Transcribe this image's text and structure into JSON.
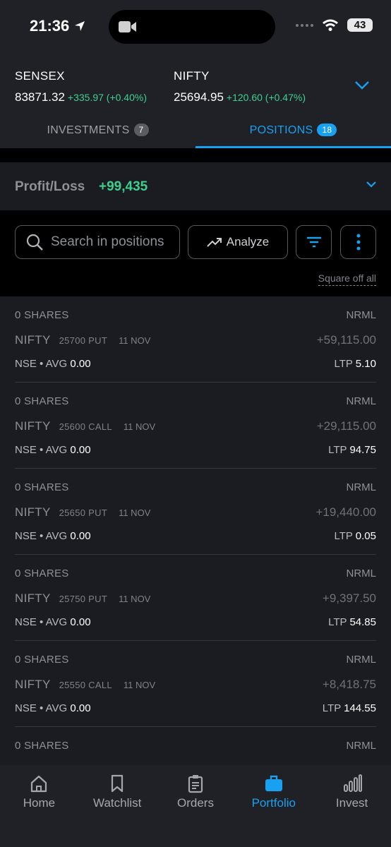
{
  "status_bar": {
    "time": "21:36",
    "battery": "43"
  },
  "indices": [
    {
      "name": "SENSEX",
      "value": "83871.32",
      "change": "+335.97 (+0.40%)"
    },
    {
      "name": "NIFTY",
      "value": "25694.95",
      "change": "+120.60 (+0.47%)"
    }
  ],
  "tabs": [
    {
      "label": "INVESTMENTS",
      "count": "7"
    },
    {
      "label": "POSITIONS",
      "count": "18"
    }
  ],
  "pnl": {
    "label": "Profit/Loss",
    "value": "+99,435"
  },
  "toolbar": {
    "search_placeholder": "Search in positions",
    "analyze_label": "Analyze",
    "square_off_label": "Square off all"
  },
  "positions": [
    {
      "qty": "0 SHARES",
      "product": "NRML",
      "symbol": "NIFTY",
      "strike": "25700 PUT",
      "expiry": "11 NOV",
      "pnl": "+59,115.00",
      "exchange": "NSE",
      "avg_label": "AVG",
      "avg": "0.00",
      "ltp_label": "LTP",
      "ltp": "5.10"
    },
    {
      "qty": "0 SHARES",
      "product": "NRML",
      "symbol": "NIFTY",
      "strike": "25600 CALL",
      "expiry": "11 NOV",
      "pnl": "+29,115.00",
      "exchange": "NSE",
      "avg_label": "AVG",
      "avg": "0.00",
      "ltp_label": "LTP",
      "ltp": "94.75"
    },
    {
      "qty": "0 SHARES",
      "product": "NRML",
      "symbol": "NIFTY",
      "strike": "25650 PUT",
      "expiry": "11 NOV",
      "pnl": "+19,440.00",
      "exchange": "NSE",
      "avg_label": "AVG",
      "avg": "0.00",
      "ltp_label": "LTP",
      "ltp": "0.05"
    },
    {
      "qty": "0 SHARES",
      "product": "NRML",
      "symbol": "NIFTY",
      "strike": "25750 PUT",
      "expiry": "11 NOV",
      "pnl": "+9,397.50",
      "exchange": "NSE",
      "avg_label": "AVG",
      "avg": "0.00",
      "ltp_label": "LTP",
      "ltp": "54.85"
    },
    {
      "qty": "0 SHARES",
      "product": "NRML",
      "symbol": "NIFTY",
      "strike": "25550 CALL",
      "expiry": "11 NOV",
      "pnl": "+8,418.75",
      "exchange": "NSE",
      "avg_label": "AVG",
      "avg": "0.00",
      "ltp_label": "LTP",
      "ltp": "144.55"
    },
    {
      "qty": "0 SHARES",
      "product": "NRML"
    }
  ],
  "bottom_nav": [
    {
      "label": "Home",
      "icon": "home-icon"
    },
    {
      "label": "Watchlist",
      "icon": "bookmark-icon"
    },
    {
      "label": "Orders",
      "icon": "clipboard-icon"
    },
    {
      "label": "Portfolio",
      "icon": "briefcase-icon"
    },
    {
      "label": "Invest",
      "icon": "bar-chart-icon"
    }
  ],
  "colors": {
    "accent": "#1aa0f0",
    "profit": "#3ecf8e",
    "background": "#1a1c21"
  }
}
